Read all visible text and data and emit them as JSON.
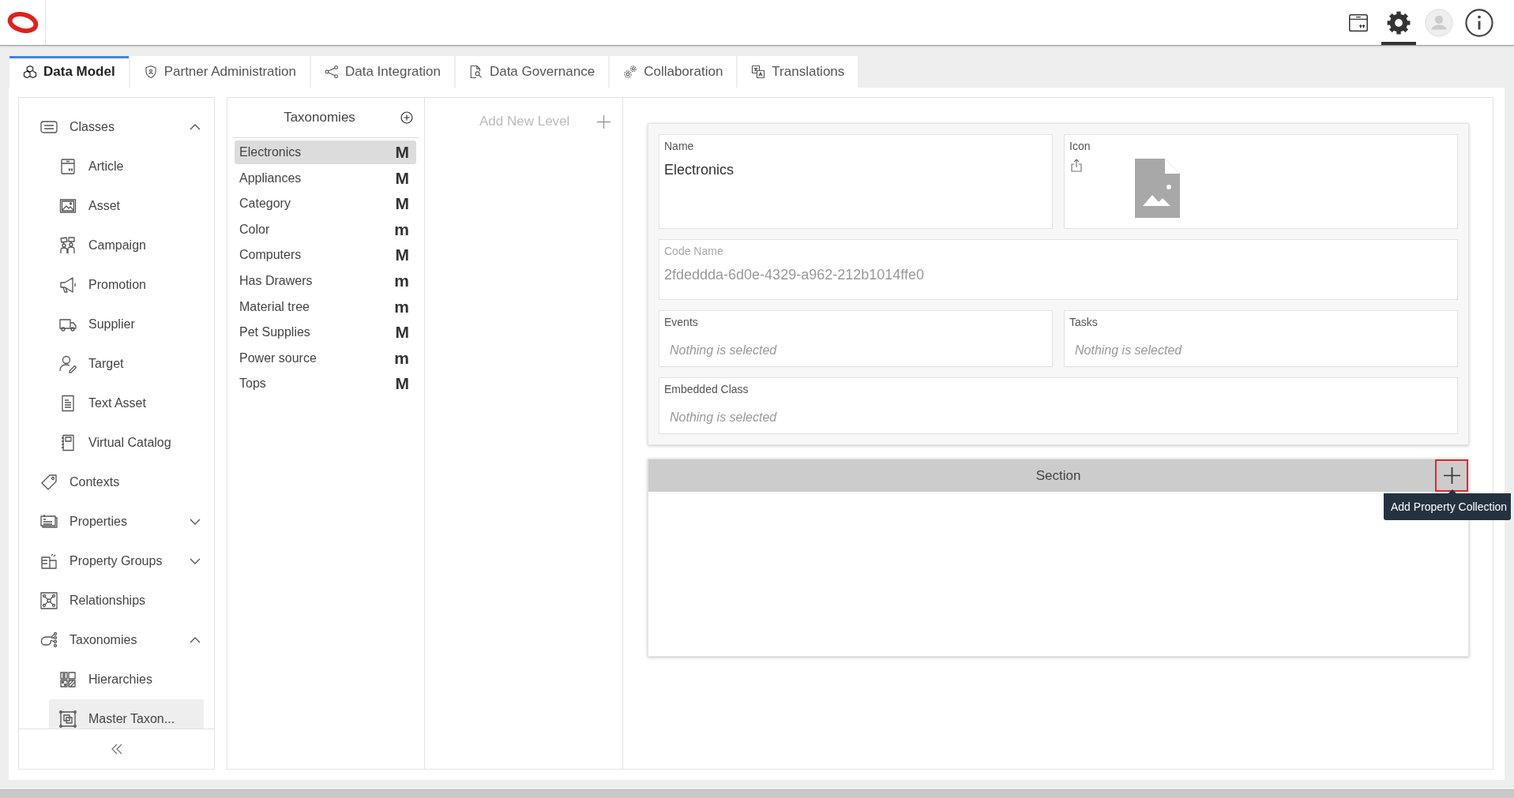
{
  "header": {
    "toolbar": [
      {
        "selected": false
      },
      {
        "selected": true
      },
      {
        "selected": false
      },
      {
        "selected": false
      }
    ]
  },
  "tabs": [
    {
      "label": "Data Model",
      "selected": true
    },
    {
      "label": "Partner Administration",
      "selected": false
    },
    {
      "label": "Data Integration",
      "selected": false
    },
    {
      "label": "Data Governance",
      "selected": false
    },
    {
      "label": "Collaboration",
      "selected": false
    },
    {
      "label": "Translations",
      "selected": false
    }
  ],
  "sidebar": {
    "items": [
      {
        "label": "Classes",
        "selected": false,
        "expanded": true,
        "children": [
          {
            "label": "Article",
            "selected": false
          },
          {
            "label": "Asset",
            "selected": false
          },
          {
            "label": "Campaign",
            "selected": false
          },
          {
            "label": "Promotion",
            "selected": false
          },
          {
            "label": "Supplier",
            "selected": false
          },
          {
            "label": "Target",
            "selected": false
          },
          {
            "label": "Text Asset",
            "selected": false
          },
          {
            "label": "Virtual Catalog",
            "selected": false
          }
        ]
      },
      {
        "label": "Contexts",
        "selected": false
      },
      {
        "label": "Properties",
        "selected": false,
        "expanded": false
      },
      {
        "label": "Property Groups",
        "selected": false,
        "expanded": false
      },
      {
        "label": "Relationships",
        "selected": false
      },
      {
        "label": "Taxonomies",
        "selected": false,
        "expanded": true,
        "children": [
          {
            "label": "Hierarchies",
            "selected": false
          },
          {
            "label": "Master Taxon...",
            "selected": true
          }
        ]
      }
    ]
  },
  "taxonomies": {
    "title": "Taxonomies",
    "items": [
      {
        "label": "Electronics",
        "badge": "M",
        "selected": true
      },
      {
        "label": "Appliances",
        "badge": "M",
        "selected": false
      },
      {
        "label": "Category",
        "badge": "M",
        "selected": false
      },
      {
        "label": "Color",
        "badge": "m",
        "selected": false
      },
      {
        "label": "Computers",
        "badge": "M",
        "selected": false
      },
      {
        "label": "Has Drawers",
        "badge": "m",
        "selected": false
      },
      {
        "label": "Material tree",
        "badge": "m",
        "selected": false
      },
      {
        "label": "Pet Supplies",
        "badge": "M",
        "selected": false
      },
      {
        "label": "Power source",
        "badge": "m",
        "selected": false
      },
      {
        "label": "Tops",
        "badge": "M",
        "selected": false
      }
    ]
  },
  "levels": {
    "add_label": "Add New Level"
  },
  "form": {
    "rows": [
      [
        {
          "kind": "text",
          "label": "Name",
          "value": "Electronics",
          "disabled": false
        },
        {
          "kind": "icon",
          "label": "Icon"
        }
      ],
      [
        {
          "kind": "text",
          "label": "Code Name",
          "value": "2fdeddda-6d0e-4329-a962-212b1014ffe0",
          "disabled": true
        }
      ],
      [
        {
          "kind": "select",
          "label": "Events",
          "placeholder": "Nothing is selected"
        },
        {
          "kind": "select",
          "label": "Tasks",
          "placeholder": "Nothing is selected"
        }
      ],
      [
        {
          "kind": "select",
          "label": "Embedded Class",
          "placeholder": "Nothing is selected"
        }
      ]
    ]
  },
  "section": {
    "title": "Section",
    "add_button": {
      "focused": true,
      "tooltip": "Add Property Collection"
    }
  }
}
